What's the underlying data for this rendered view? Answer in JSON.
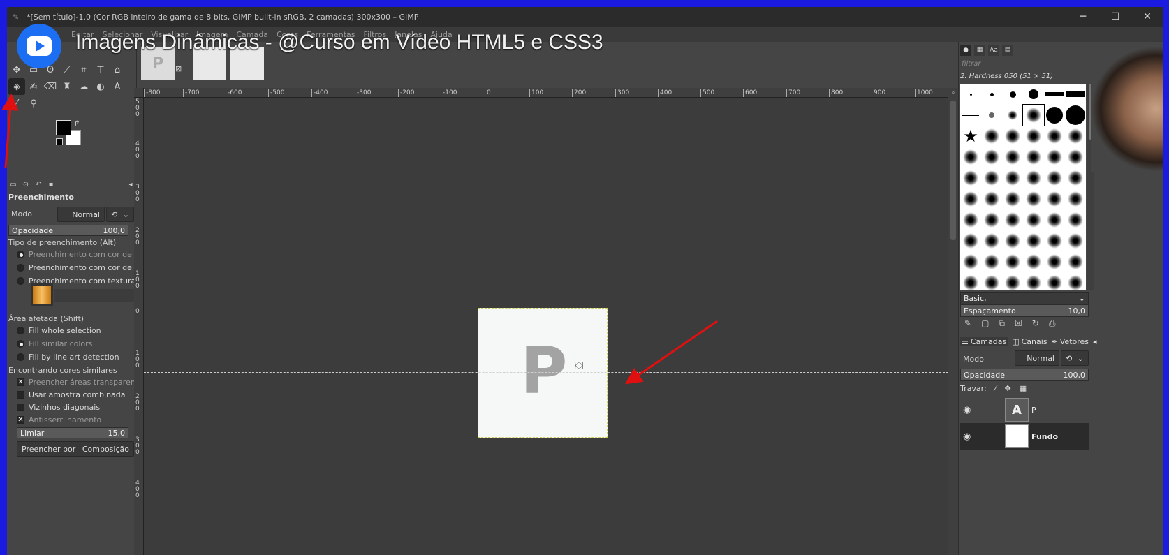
{
  "window": {
    "title": "*[Sem título]-1.0 (Cor RGB inteiro de gama de 8 bits, GIMP built-in sRGB, 2 camadas) 300x300 – GIMP",
    "minimize": "─",
    "maximize": "☐",
    "close": "✕"
  },
  "menu": [
    "Editar",
    "Selecionar",
    "Visualizar",
    "Imagem",
    "Camada",
    "Cores",
    "Ferramentas",
    "Filtros",
    "Janelas",
    "Ajuda"
  ],
  "overlay": {
    "title": "Imagens Dinâmicas - @Curso em Vídeo HTML5 e CSS3"
  },
  "tool_options": {
    "title": "Preenchimento",
    "mode_label": "Modo",
    "mode_value": "Normal",
    "opacity_label": "Opacidade",
    "opacity_value": "100,0",
    "fill_type_label": "Tipo de preenchimento  (Alt)",
    "fill_fg": "Preenchimento com cor de frent",
    "fill_bg": "Preenchimento com cor de fund",
    "fill_pattern": "Preenchimento com textura",
    "area_label": "Área afetada  (Shift)",
    "area_whole": "Fill whole selection",
    "area_similar": "Fill similar colors",
    "area_lineart": "Fill by line art detection",
    "similar_label": "Encontrando cores similares",
    "fill_transparent": "Preencher áreas transparentes",
    "sample_merged": "Usar amostra combinada",
    "diagonal": "Vizinhos diagonais",
    "antialias": "Antisserrilhamento",
    "threshold_label": "Limiar",
    "threshold_value": "15,0",
    "fill_by_label": "Preencher por",
    "fill_by_value": "Composição"
  },
  "ruler": {
    "h_ticks": [
      "-800",
      "-700",
      "-600",
      "-500",
      "-400",
      "-300",
      "-200",
      "-100",
      "0",
      "100",
      "200",
      "300",
      "400",
      "500",
      "600",
      "700",
      "800",
      "900",
      "1000"
    ],
    "v_ticks": [
      "500",
      "400",
      "300",
      "200",
      "100",
      "0",
      "100",
      "200",
      "300",
      "400"
    ]
  },
  "canvas": {
    "image_letter": "P"
  },
  "brushes": {
    "filter_placeholder": "filtrar",
    "current": "2. Hardness 050 (51 × 51)",
    "tag": "Basic,",
    "spacing_label": "Espaçamento",
    "spacing_value": "10,0"
  },
  "layers": {
    "tabs": [
      "Camadas",
      "Canais",
      "Vetores"
    ],
    "mode_label": "Modo",
    "mode_value": "Normal",
    "opacity_label": "Opacidade",
    "opacity_value": "100,0",
    "lock_label": "Travar:",
    "items": [
      {
        "name": "P",
        "thumb": "A"
      },
      {
        "name": "Fundo",
        "thumb": ""
      }
    ]
  },
  "icons": {
    "overlay_logo": "play-logo-icon",
    "tools": [
      "move-icon",
      "rect-select-icon",
      "lasso-icon",
      "fuzzy-select-icon",
      "crop-icon",
      "align-icon",
      "warp-icon",
      "bucket-fill-icon",
      "paintbrush-icon",
      "eraser-icon",
      "clone-icon",
      "smudge-icon",
      "text-icon",
      "color-picker-icon",
      "zoom-icon"
    ]
  },
  "colors": {
    "foreground": "#000000",
    "background": "#ffffff",
    "annotation_arrow": "#e01010"
  }
}
